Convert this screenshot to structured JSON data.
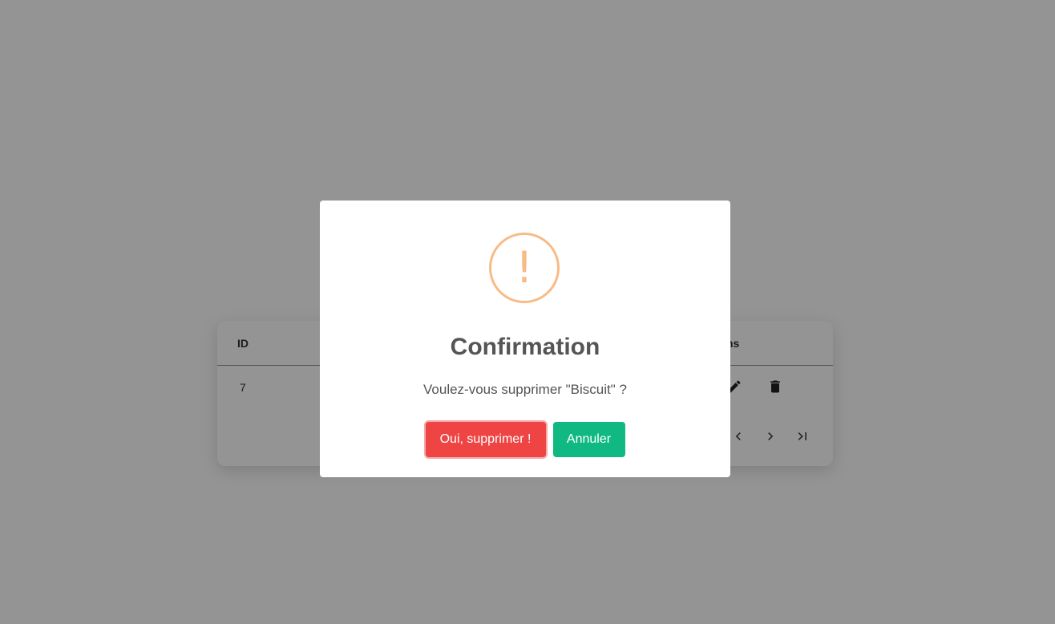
{
  "table": {
    "columns": {
      "id": "ID",
      "actions": "Actions"
    },
    "rows": [
      {
        "id": "7"
      }
    ],
    "row_action_icons": [
      "edit-icon",
      "delete-icon"
    ],
    "pagination_icons": [
      "chevron-left-icon",
      "chevron-right-icon",
      "last-page-icon"
    ]
  },
  "modal": {
    "icon": "warning-icon",
    "icon_glyph": "!",
    "icon_color": "#f8bb86",
    "title": "Confirmation",
    "text": "Voulez-vous supprimer \"Biscuit\" ?",
    "confirm_label": "Oui, supprimer !",
    "cancel_label": "Annuler",
    "confirm_color": "#ef4444",
    "cancel_color": "#10b981"
  }
}
